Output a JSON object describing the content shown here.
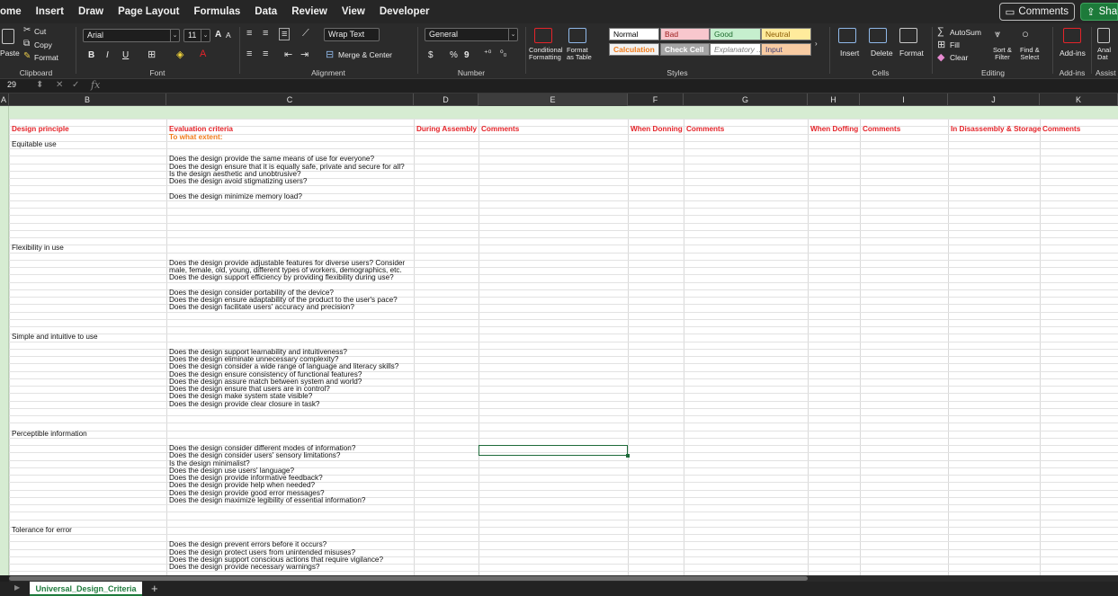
{
  "ribbon_tabs": [
    "ome",
    "Insert",
    "Draw",
    "Page Layout",
    "Formulas",
    "Data",
    "Review",
    "View",
    "Developer"
  ],
  "top_buttons": {
    "comments": "Comments",
    "share": "Share"
  },
  "clipboard": {
    "cut": "Cut",
    "copy": "Copy",
    "format": "Format",
    "paste": "Paste",
    "label": "Clipboard"
  },
  "font": {
    "name": "Arial",
    "size": "11",
    "label": "Font",
    "bold": "B",
    "italic": "I",
    "underline": "U",
    "grow": "A",
    "shrink": "A"
  },
  "alignment": {
    "wrap": "Wrap Text",
    "merge": "Merge & Center",
    "label": "Alignment"
  },
  "number": {
    "format": "General",
    "currency": "$",
    "percent": "%",
    "comma": "9",
    "label": "Number"
  },
  "styles_group": {
    "conditional": "Conditional\nFormatting",
    "format_table": "Format\nas Table",
    "label": "Styles",
    "cells": [
      {
        "text": "Normal",
        "bg": "#ffffff",
        "fg": "#000000"
      },
      {
        "text": "Bad",
        "bg": "#f8c7cd",
        "fg": "#9c1b1b"
      },
      {
        "text": "Good",
        "bg": "#c6efce",
        "fg": "#1c6b2c"
      },
      {
        "text": "Neutral",
        "bg": "#ffeb9c",
        "fg": "#8a5a00"
      },
      {
        "text": "Calculation",
        "bg": "#f2f2f2",
        "fg": "#f07c1c"
      },
      {
        "text": "Check Cell",
        "bg": "#a5a5a5",
        "fg": "#ffffff"
      },
      {
        "text": "Explanatory ...",
        "bg": "#ffffff",
        "fg": "#7f7f7f"
      },
      {
        "text": "Input",
        "bg": "#f8cba2",
        "fg": "#3f3f76"
      }
    ]
  },
  "cells_group": {
    "insert": "Insert",
    "delete": "Delete",
    "format": "Format",
    "label": "Cells"
  },
  "editing": {
    "autosum": "AutoSum",
    "fill": "Fill",
    "clear": "Clear",
    "sort": "Sort &\nFilter",
    "find": "Find &\nSelect",
    "label": "Editing"
  },
  "addins": {
    "addins": "Add-ins",
    "label": "Add-ins",
    "analyze": "Anal\nDat",
    "assist_label": "Assist"
  },
  "formula_bar": {
    "cell_ref": "29",
    "fx": "fx"
  },
  "columns": [
    "A",
    "B",
    "C",
    "D",
    "E",
    "F",
    "G",
    "H",
    "I",
    "J",
    "K"
  ],
  "header_row": {
    "principle": "Design principle",
    "criteria": "Evaluation criteria",
    "during": "During Assembly",
    "c1": "Comments",
    "donning": "When Donning",
    "c2": "Comments",
    "doffing": "When Doffing",
    "c3": "Comments",
    "disassembly": "In Disassembly & Storage",
    "c4": "Comments"
  },
  "subheader": "To what extent:",
  "principles": [
    "Equitable use",
    "Flexibility in use",
    "Simple and intuitive to use",
    "Perceptible information",
    "Tolerance for error"
  ],
  "criteria": [
    "Does the design provide the same means of use for everyone?",
    "Does the design ensure that it is equally safe, private and secure for all?",
    "Is the design aesthetic and unobtrusive?",
    "Does the design avoid stigmatizing users?",
    "Does the design minimize memory load?",
    "Does the design provide adjustable features for diverse users? Consider",
    "male, female, old, young, different types of workers, demographics, etc.",
    "Does the design support efficiency by providing flexibility during use?",
    "Does the design consider portability of the device?",
    "Does the design ensure adaptability of the product to the user's pace?",
    "Does the design facilitate users' accuracy and precision?",
    "Does the design support learnability and intuitiveness?",
    "Does the design eliminate unnecessary complexity?",
    "Does the design consider a wide range of language and literacy skills?",
    "Does the design ensure consistency of functional features?",
    "Does the design assure match between system and world?",
    "Does the design ensure that users are in control?",
    "Does the design make system state visible?",
    "Does the design provide clear closure in task?",
    "Does the design consider different modes of information?",
    "Does the design consider users' sensory limitations?",
    "Is the design minimalist?",
    "Does the design use users' language?",
    "Does the design provide informative feedback?",
    "Does the design provide help when needed?",
    "Does the design provide good error messages?",
    "Does the design maximize legibility of essential information?",
    "Does the design prevent errors before it occurs?",
    "Does the design protect users from unintended misuses?",
    "Does the design support conscious actions that require vigilance?",
    "Does the design provide necessary warnings?"
  ],
  "sheet_tab": "Universal_Design_Criteria",
  "add_sheet": "+"
}
